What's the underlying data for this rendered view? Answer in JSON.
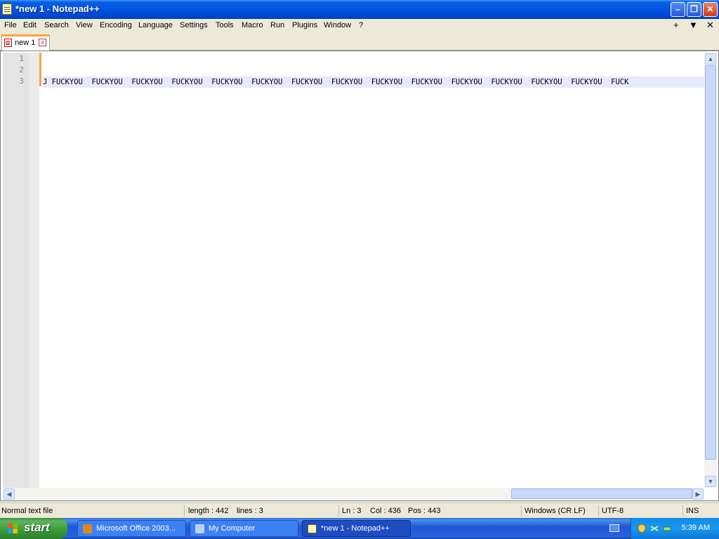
{
  "window": {
    "title": "*new 1 - Notepad++",
    "controls": {
      "minimize": "–",
      "maximize": "❐",
      "close": "✕"
    }
  },
  "menu": {
    "items": [
      "File",
      "Edit",
      "Search",
      "View",
      "Encoding",
      "Language",
      "Settings",
      "Tools",
      "Macro",
      "Run",
      "Plugins",
      "Window",
      "?"
    ],
    "right_icons": {
      "add": "+",
      "dropdown": "▼",
      "close": "✕"
    }
  },
  "tabs": [
    {
      "label": "new 1",
      "close": "x"
    }
  ],
  "editor": {
    "line_numbers": [
      "1",
      "2",
      "3"
    ],
    "lines": [
      "",
      "",
      "J FUCKYOU  FUCKYOU  FUCKYOU  FUCKYOU  FUCKYOU  FUCKYOU  FUCKYOU  FUCKYOU  FUCKYOU  FUCKYOU  FUCKYOU  FUCKYOU  FUCKYOU  FUCKYOU  FUCK"
    ],
    "current_line": 3
  },
  "statusbar": {
    "file_type": "Normal text file",
    "length": "length : 442",
    "lines": "lines : 3",
    "ln": "Ln : 3",
    "col": "Col : 436",
    "pos": "Pos : 443",
    "eol": "Windows (CR LF)",
    "encoding": "UTF-8",
    "mode": "INS"
  },
  "taskbar": {
    "start_label": "start",
    "buttons": [
      {
        "label": "Microsoft Office 2003...",
        "active": false
      },
      {
        "label": "My Computer",
        "active": false
      },
      {
        "label": "*new 1 - Notepad++",
        "active": true
      }
    ],
    "clock": "5:39 AM"
  },
  "colors": {
    "titlebar_blue": "#0055e5",
    "tab_accent": "#fca53c",
    "current_line": "#e8e8ff",
    "start_green": "#379b37",
    "close_red": "#cf3d1b"
  }
}
